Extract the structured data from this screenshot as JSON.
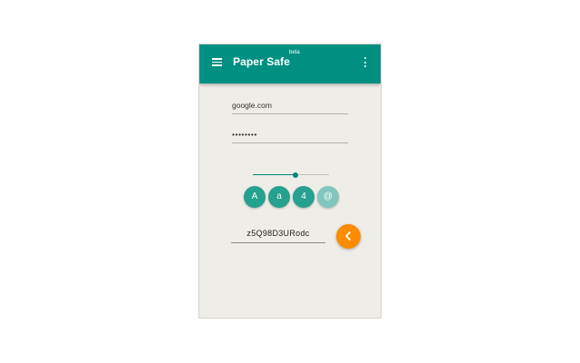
{
  "appbar": {
    "title": "Paper Safe",
    "beta_label": "beta",
    "menu_icon": "hamburger-menu-icon",
    "more_icon": "more-vert-icon",
    "color": "#009082"
  },
  "form": {
    "site_value": "google.com",
    "password_value": "••••••••"
  },
  "length_slider": {
    "level": 0.56
  },
  "charset_toggles": [
    {
      "label": "A",
      "active": true
    },
    {
      "label": "a",
      "active": true
    },
    {
      "label": "4",
      "active": true
    },
    {
      "label": "@",
      "active": false
    }
  ],
  "generated_password": "z5Q98D3URodc",
  "copy_button": {
    "icon": "chevron-left-icon",
    "color": "#fb8c00"
  }
}
